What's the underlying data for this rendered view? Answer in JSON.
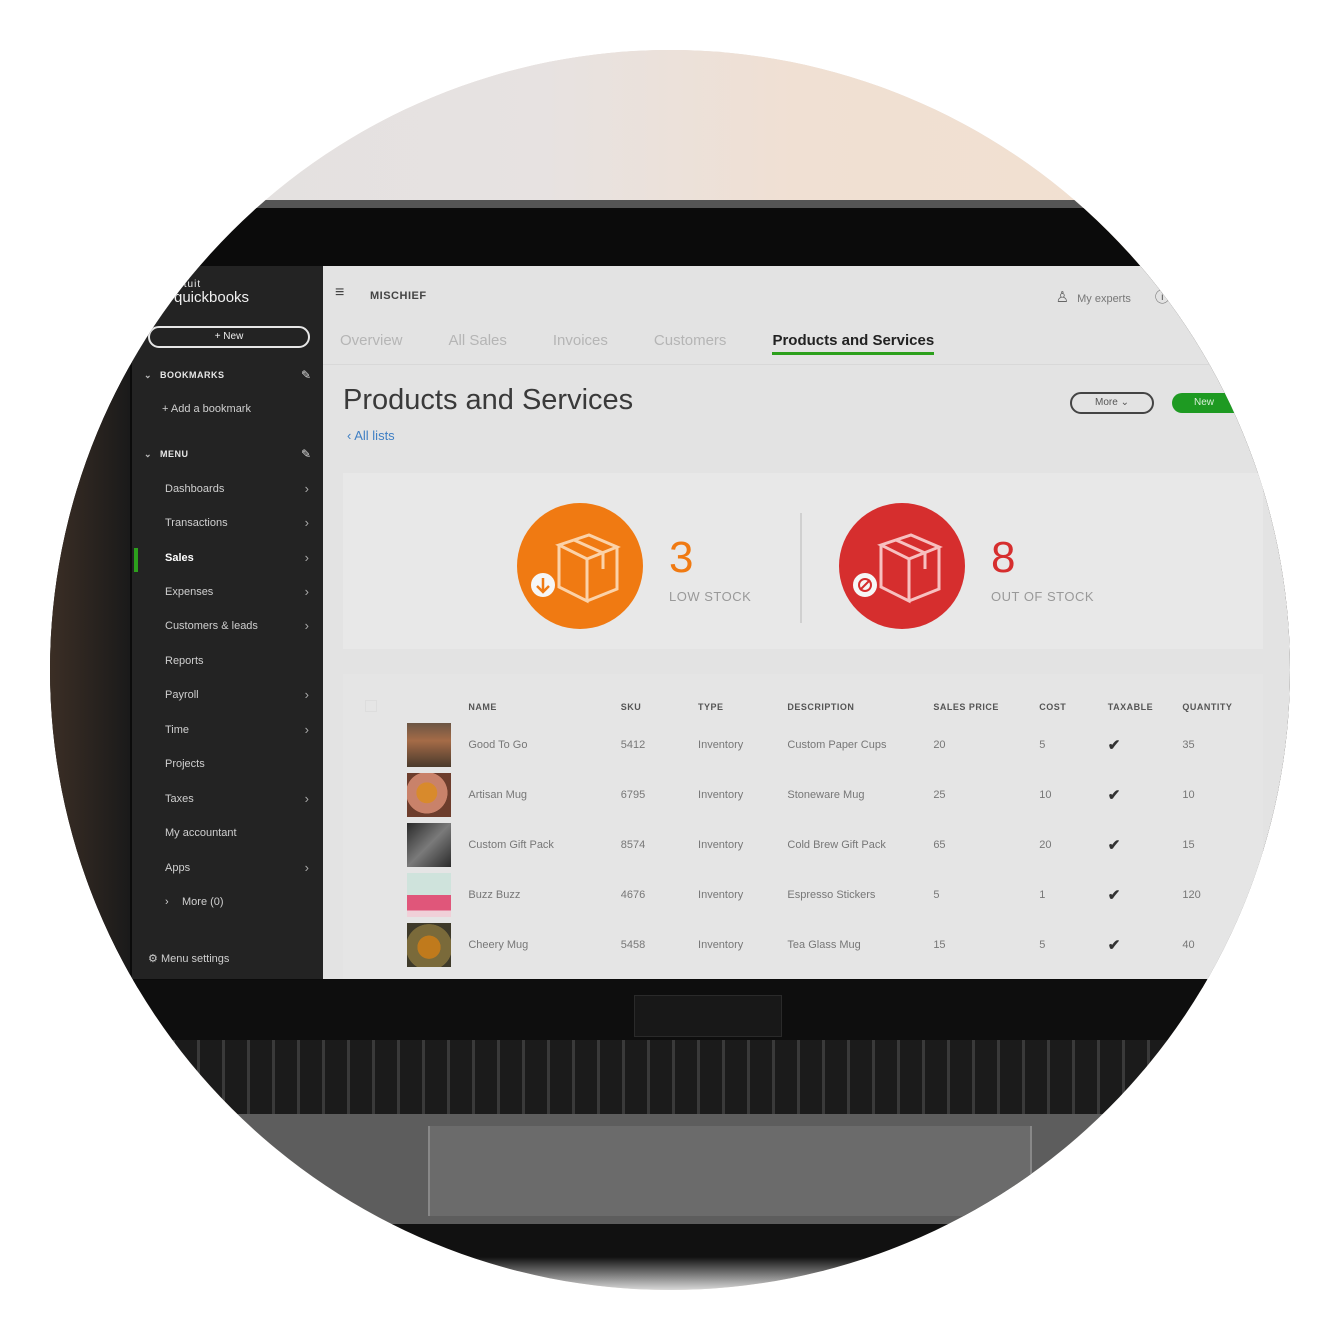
{
  "sidebar": {
    "logo_top": "intuit",
    "logo_main": "quickbooks",
    "new_button": "+ New",
    "bookmarks_heading": "BOOKMARKS",
    "add_bookmark": "+ Add a bookmark",
    "menu_heading": "MENU",
    "items": [
      {
        "label": "Dashboards",
        "arrow": true
      },
      {
        "label": "Transactions",
        "arrow": true
      },
      {
        "label": "Sales",
        "arrow": true,
        "active": true
      },
      {
        "label": "Expenses",
        "arrow": true
      },
      {
        "label": "Customers & leads",
        "arrow": true
      },
      {
        "label": "Reports",
        "arrow": false
      },
      {
        "label": "Payroll",
        "arrow": true
      },
      {
        "label": "Time",
        "arrow": true
      },
      {
        "label": "Projects",
        "arrow": false
      },
      {
        "label": "Taxes",
        "arrow": true
      },
      {
        "label": "My accountant",
        "arrow": false
      },
      {
        "label": "Apps",
        "arrow": true
      }
    ],
    "more": "More (0)",
    "menu_settings": "Menu settings"
  },
  "topbar": {
    "company": "MISCHIEF",
    "my_experts": "My experts",
    "help": "Help"
  },
  "tabs": [
    {
      "label": "Overview"
    },
    {
      "label": "All Sales"
    },
    {
      "label": "Invoices"
    },
    {
      "label": "Customers"
    },
    {
      "label": "Products and Services",
      "active": true
    }
  ],
  "page": {
    "title": "Products and Services",
    "all_lists": "All lists",
    "more_button": "More",
    "new_button": "New"
  },
  "stock": {
    "low": {
      "count": "3",
      "label": "LOW STOCK",
      "color": "#f07a12"
    },
    "out": {
      "count": "8",
      "label": "OUT OF STOCK",
      "color": "#d62e2e"
    }
  },
  "table": {
    "columns": [
      "NAME",
      "SKU",
      "TYPE",
      "DESCRIPTION",
      "SALES PRICE",
      "COST",
      "TAXABLE",
      "QUANTITY"
    ],
    "rows": [
      {
        "name": "Good To Go",
        "sku": "5412",
        "type": "Inventory",
        "description": "Custom Paper Cups",
        "price": "20",
        "cost": "5",
        "taxable": "✔",
        "qty": "35"
      },
      {
        "name": "Artisan Mug",
        "sku": "6795",
        "type": "Inventory",
        "description": "Stoneware Mug",
        "price": "25",
        "cost": "10",
        "taxable": "✔",
        "qty": "10"
      },
      {
        "name": "Custom Gift Pack",
        "sku": "8574",
        "type": "Inventory",
        "description": "Cold Brew Gift Pack",
        "price": "65",
        "cost": "20",
        "taxable": "✔",
        "qty": "15"
      },
      {
        "name": "Buzz Buzz",
        "sku": "4676",
        "type": "Inventory",
        "description": "Espresso Stickers",
        "price": "5",
        "cost": "1",
        "taxable": "✔",
        "qty": "120"
      },
      {
        "name": "Cheery Mug",
        "sku": "5458",
        "type": "Inventory",
        "description": "Tea Glass Mug",
        "price": "15",
        "cost": "5",
        "taxable": "✔",
        "qty": "40"
      }
    ]
  },
  "colors": {
    "brand_green": "#2ca01c",
    "low_stock": "#f07a12",
    "out_of_stock": "#d62e2e"
  }
}
